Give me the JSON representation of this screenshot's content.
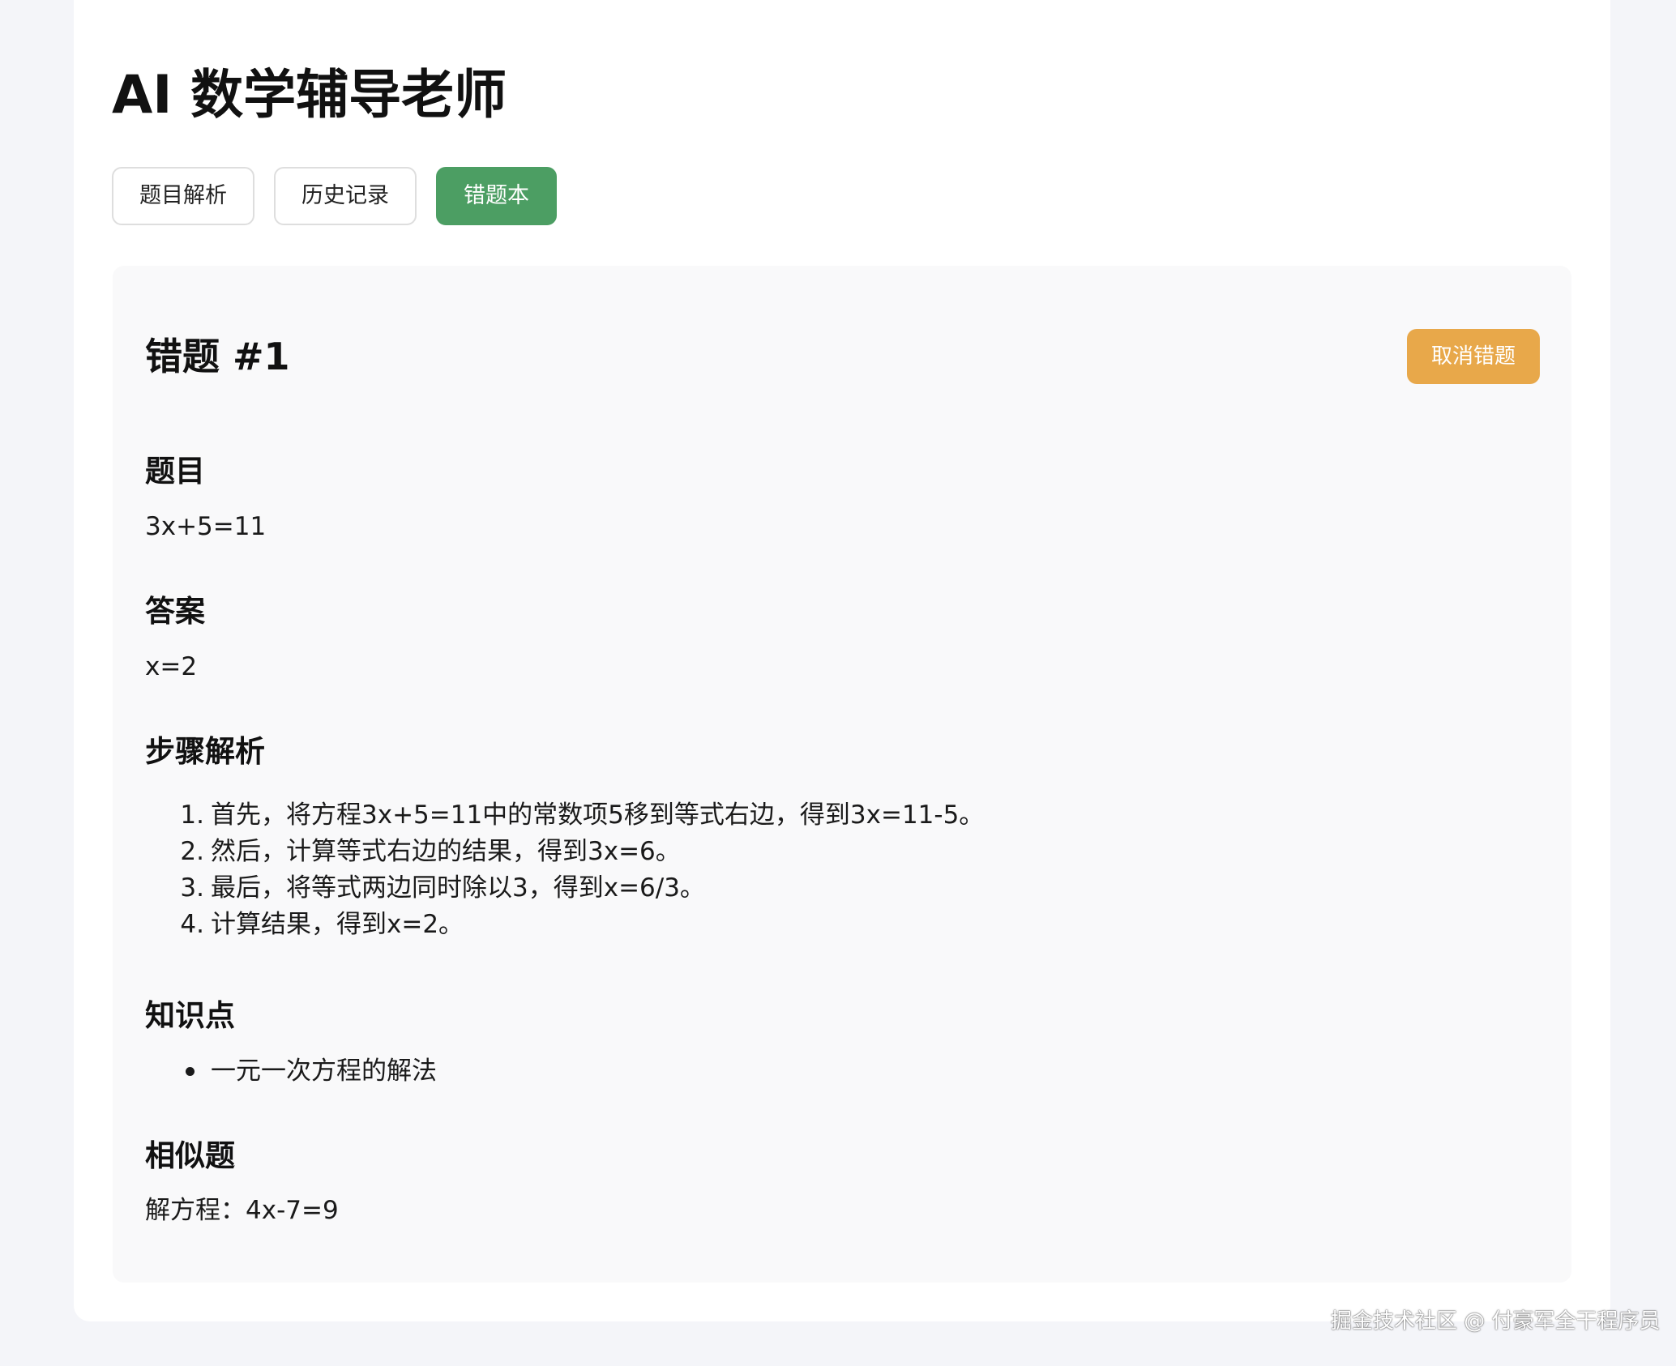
{
  "header": {
    "title": "AI 数学辅导老师"
  },
  "tabs": [
    {
      "label": "题目解析",
      "active": false
    },
    {
      "label": "历史记录",
      "active": false
    },
    {
      "label": "错题本",
      "active": true
    }
  ],
  "mistake": {
    "title": "错题 #1",
    "remove_label": "取消错题",
    "question_heading": "题目",
    "question": "3x+5=11",
    "answer_heading": "答案",
    "answer": "x=2",
    "steps_heading": "步骤解析",
    "steps": [
      {
        "num": "1.",
        "text": "首先，将方程3x+5=11中的常数项5移到等式右边，得到3x=11-5。"
      },
      {
        "num": "2.",
        "text": "然后，计算等式右边的结果，得到3x=6。"
      },
      {
        "num": "3.",
        "text": "最后，将等式两边同时除以3，得到x=6/3。"
      },
      {
        "num": "4.",
        "text": "计算结果，得到x=2。"
      }
    ],
    "knowledge_heading": "知识点",
    "knowledge_points": [
      "一元一次方程的解法"
    ],
    "similar_heading": "相似题",
    "similar": "解方程：4x-7=9"
  },
  "watermark": "掘金技术社区 @ 付豪军全干程序员",
  "colors": {
    "page_background": "#f4f5f9",
    "active_tab": "#4c9e63",
    "remove_button": "#e8a84a",
    "card_background": "#f9f9fa"
  }
}
